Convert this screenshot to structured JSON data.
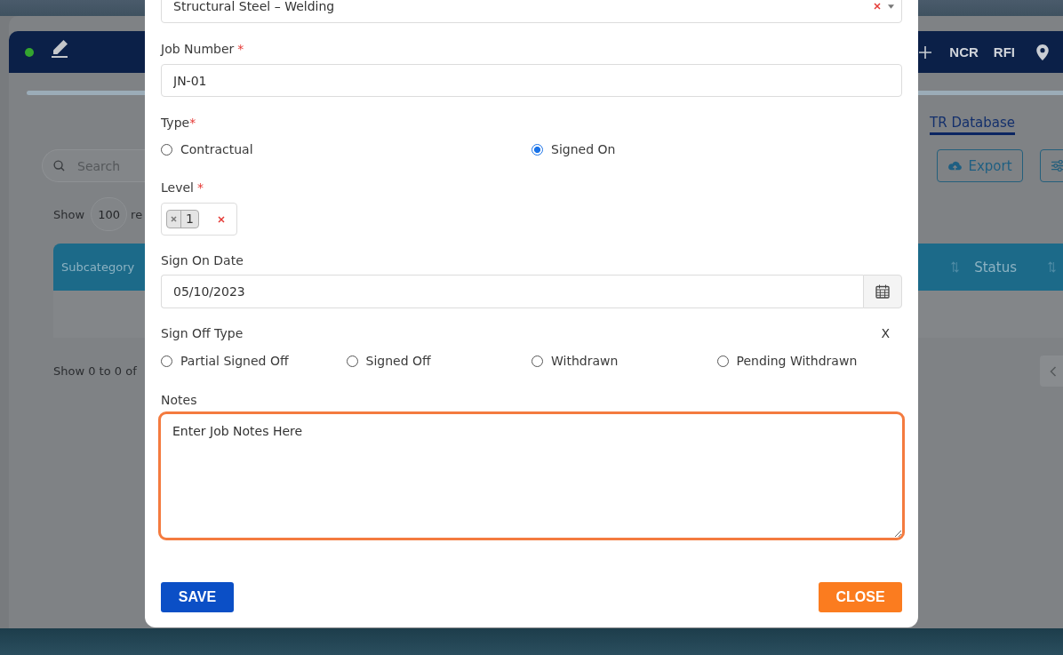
{
  "background_app": {
    "header_links": [
      "NCR",
      "RFI"
    ],
    "tab": {
      "label": "TR Database",
      "selected": true
    },
    "search": {
      "placeholder": "Search"
    },
    "export_button": "Export",
    "page_size": {
      "label": "Show",
      "value": "100",
      "label_after": "re"
    },
    "table": {
      "columns": [
        "Subcategory",
        "Status"
      ]
    },
    "footer_info": "Show 0 to 0 of"
  },
  "modal": {
    "category": {
      "value": "Structural Steel – Welding"
    },
    "job_number": {
      "label": "Job Number",
      "required_mark": "*",
      "value": "JN-01"
    },
    "type": {
      "label": "Type",
      "required_mark": "*",
      "options": [
        {
          "label": "Contractual",
          "selected": false
        },
        {
          "label": "Signed On",
          "selected": true
        }
      ]
    },
    "level": {
      "label": "Level",
      "required_mark": "*",
      "tags": [
        "1"
      ]
    },
    "sign_on_date": {
      "label": "Sign On Date",
      "value": "05/10/2023"
    },
    "sign_off_type": {
      "label": "Sign Off Type",
      "clear": "X",
      "options": [
        {
          "label": "Partial Signed Off",
          "selected": false
        },
        {
          "label": "Signed Off",
          "selected": false
        },
        {
          "label": "Withdrawn",
          "selected": false
        },
        {
          "label": "Pending Withdrawn",
          "selected": false
        }
      ]
    },
    "notes": {
      "label": "Notes",
      "value": "Enter Job Notes Here",
      "focused": true
    },
    "buttons": [
      {
        "label": "SAVE",
        "kind": "primary"
      },
      {
        "label": "CLOSE",
        "kind": "secondary"
      }
    ]
  }
}
